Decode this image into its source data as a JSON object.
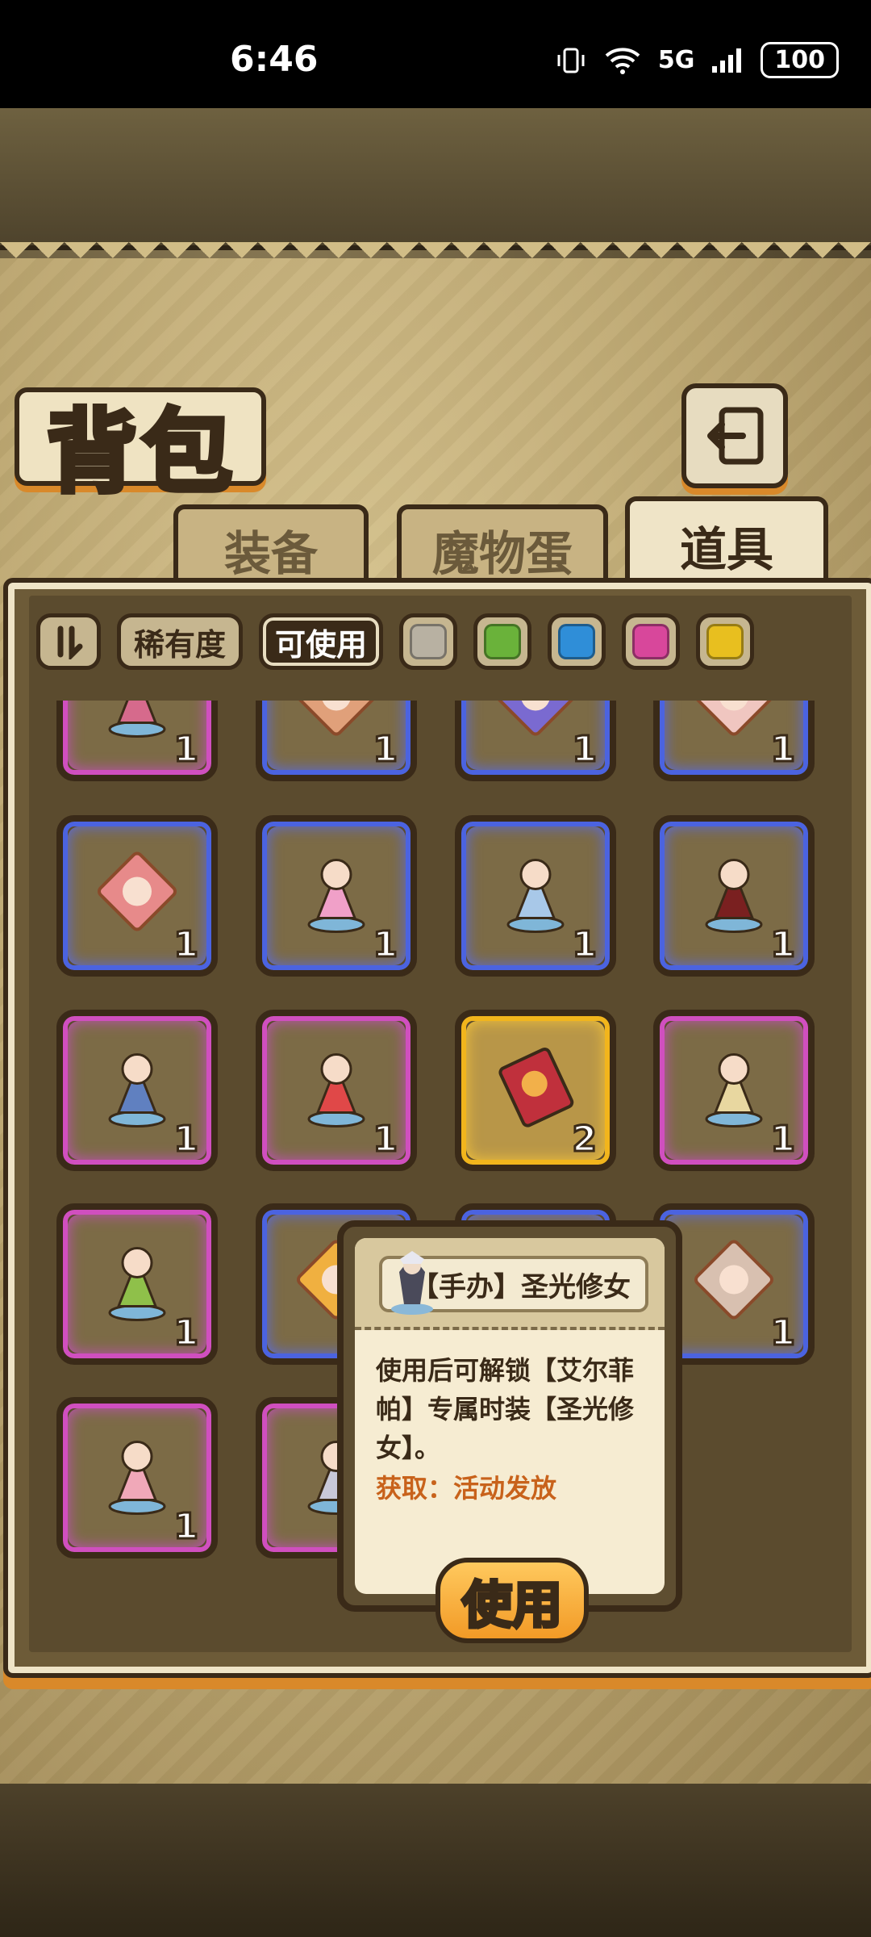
{
  "status_bar": {
    "time": "6:46",
    "network": "5G",
    "battery": "100"
  },
  "header": {
    "title": "背包"
  },
  "tabs": [
    {
      "label": "装备",
      "active": false
    },
    {
      "label": "魔物蛋",
      "active": false
    },
    {
      "label": "道具",
      "active": true
    }
  ],
  "filters": {
    "rarity_label": "稀有度",
    "usable_label": "可使用",
    "swatches": [
      "#b8b1a2",
      "#6ab23a",
      "#2f8ed8",
      "#d8479b",
      "#e8bf1f"
    ]
  },
  "items": [
    {
      "rarity": "purple",
      "icon": "figure-pink-demon-icon",
      "color": "#d66a8c",
      "count": "1"
    },
    {
      "rarity": "blue",
      "icon": "puzzle-portrait-icon",
      "color": "#e0a07a",
      "count": "1"
    },
    {
      "rarity": "blue",
      "icon": "puzzle-portrait-icon",
      "color": "#7a6ad0",
      "count": "1"
    },
    {
      "rarity": "blue",
      "icon": "puzzle-portrait-icon",
      "color": "#f0c6c0",
      "count": "1"
    },
    {
      "rarity": "blue",
      "icon": "puzzle-portrait-icon",
      "color": "#e78a8a",
      "count": "1"
    },
    {
      "rarity": "blue",
      "icon": "figure-pink-girl-icon",
      "color": "#f0a0c8",
      "count": "1"
    },
    {
      "rarity": "blue",
      "icon": "figure-ghost-icon",
      "color": "#a8c8e8",
      "count": "1"
    },
    {
      "rarity": "blue",
      "icon": "figure-dark-beast-icon",
      "color": "#7a2020",
      "count": "1"
    },
    {
      "rarity": "purple",
      "icon": "figure-blue-mermaid-icon",
      "color": "#6080c0",
      "count": "1"
    },
    {
      "rarity": "purple",
      "icon": "figure-cat-girl-icon",
      "color": "#e04848",
      "count": "1"
    },
    {
      "rarity": "gold",
      "icon": "red-envelope-icon",
      "color": "#c0303c",
      "count": "2"
    },
    {
      "rarity": "purple",
      "icon": "figure-knight-icon",
      "color": "#e8d7a0",
      "count": "1"
    },
    {
      "rarity": "purple",
      "icon": "figure-burger-icon",
      "color": "#8fc04a",
      "count": "1"
    },
    {
      "rarity": "blue",
      "icon": "puzzle-portrait-icon",
      "color": "#f0b040",
      "count": ""
    },
    {
      "rarity": "blue",
      "icon": "puzzle-portrait-icon",
      "color": "#c8a0a0",
      "count": ""
    },
    {
      "rarity": "blue",
      "icon": "puzzle-portrait-icon",
      "color": "#d8c0b0",
      "count": "1"
    },
    {
      "rarity": "purple",
      "icon": "figure-dragon-girl-icon",
      "color": "#f0a8b8",
      "count": "1"
    },
    {
      "rarity": "purple",
      "icon": "figure-nun-icon",
      "color": "#c8c8d8",
      "count": ""
    }
  ],
  "tooltip": {
    "name": "【手办】圣光修女",
    "desc_lines": [
      "使用后可解锁【艾尔菲",
      "帕】专属时装【圣光修",
      "女】。"
    ],
    "source": "获取：活动发放",
    "use_label": "使用"
  }
}
